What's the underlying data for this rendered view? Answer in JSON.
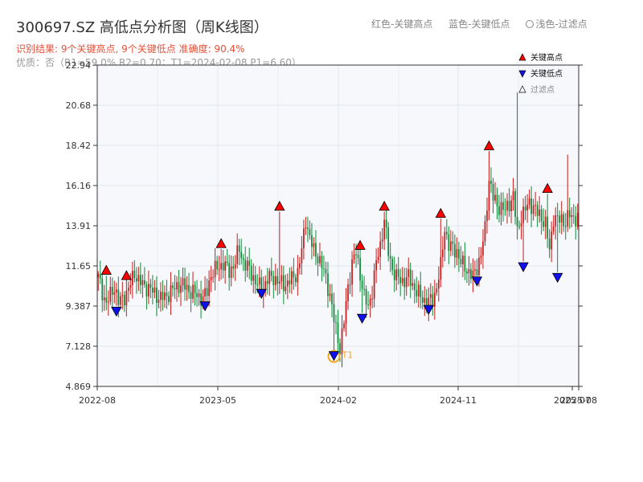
{
  "title": "300697.SZ 高低点分析图（周K线图）",
  "top_legend": {
    "red": "红色-关键高点",
    "blue": "蓝色-关键低点",
    "light": "浅色-过滤点"
  },
  "subtitle": "识别结果: 9个关键高点, 9个关键低点  准确度: 90.4%",
  "quality_line": "优质：否（R1=59.0%  R2=0.70；T1=2024-02-08 P1=6.60）",
  "colors": {
    "up": "#c81e1e",
    "down": "#118a3a",
    "high_marker": "#ff0000",
    "low_marker": "#1010ee",
    "t1_ring": "#f5a623"
  },
  "chart_data": {
    "type": "candlestick",
    "ylim": [
      4.869,
      22.94
    ],
    "yticks": [
      "22.94",
      "20.68",
      "18.42",
      "16.16",
      "13.91",
      "11.65",
      "9.387",
      "7.128",
      "4.869"
    ],
    "xticks": [
      "2022-08",
      "2023-05",
      "2024-02",
      "2024-11",
      "2025-07",
      "2025-08"
    ],
    "legend": {
      "high": "关键高点",
      "low": "关键低点",
      "filtered": "过滤点"
    },
    "t1_label": "T1",
    "close_path": [
      [
        0,
        11.0
      ],
      [
        2,
        10.2
      ],
      [
        4,
        9.5
      ],
      [
        6,
        10.0
      ],
      [
        8,
        10.5
      ],
      [
        10,
        9.6
      ],
      [
        12,
        9.8
      ],
      [
        15,
        10.3
      ],
      [
        18,
        11.3
      ],
      [
        20,
        10.8
      ],
      [
        22,
        10.6
      ],
      [
        25,
        10.4
      ],
      [
        28,
        10.1
      ],
      [
        31,
        9.8
      ],
      [
        34,
        10.0
      ],
      [
        37,
        10.3
      ],
      [
        40,
        10.6
      ],
      [
        43,
        10.5
      ],
      [
        46,
        10.2
      ],
      [
        49,
        10.0
      ],
      [
        52,
        9.8
      ],
      [
        54,
        10.2
      ],
      [
        56,
        11.2
      ],
      [
        59,
        11.5
      ],
      [
        62,
        11.8
      ],
      [
        65,
        11.3
      ],
      [
        68,
        11.9
      ],
      [
        70,
        12.6
      ],
      [
        72,
        11.9
      ],
      [
        75,
        11.4
      ],
      [
        78,
        10.8
      ],
      [
        81,
        10.3
      ],
      [
        84,
        10.9
      ],
      [
        87,
        11.0
      ],
      [
        90,
        10.7
      ],
      [
        93,
        10.6
      ],
      [
        96,
        10.9
      ],
      [
        99,
        11.3
      ],
      [
        101,
        12.5
      ],
      [
        103,
        14.3
      ],
      [
        105,
        13.2
      ],
      [
        107,
        12.5
      ],
      [
        109,
        12.2
      ],
      [
        111,
        11.6
      ],
      [
        113,
        11.0
      ],
      [
        115,
        10.0
      ],
      [
        117,
        8.6
      ],
      [
        119,
        7.6
      ],
      [
        120,
        7.0
      ],
      [
        122,
        8.5
      ],
      [
        124,
        10.5
      ],
      [
        126,
        11.8
      ],
      [
        128,
        12.4
      ],
      [
        130,
        11.2
      ],
      [
        132,
        9.9
      ],
      [
        134,
        9.3
      ],
      [
        136,
        10.3
      ],
      [
        138,
        11.8
      ],
      [
        140,
        12.8
      ],
      [
        142,
        14.3
      ],
      [
        144,
        12.4
      ],
      [
        146,
        11.5
      ],
      [
        148,
        11.0
      ],
      [
        151,
        10.8
      ],
      [
        154,
        11.0
      ],
      [
        157,
        10.4
      ],
      [
        160,
        9.9
      ],
      [
        163,
        9.6
      ],
      [
        166,
        9.7
      ],
      [
        168,
        10.5
      ],
      [
        170,
        11.6
      ],
      [
        172,
        13.8
      ],
      [
        174,
        12.8
      ],
      [
        176,
        12.6
      ],
      [
        178,
        12.5
      ],
      [
        180,
        11.8
      ],
      [
        182,
        11.6
      ],
      [
        184,
        11.3
      ],
      [
        186,
        11.0
      ],
      [
        188,
        11.6
      ],
      [
        190,
        12.3
      ],
      [
        192,
        13.7
      ],
      [
        194,
        16.6
      ],
      [
        196,
        15.5
      ],
      [
        198,
        15.0
      ],
      [
        200,
        15.0
      ],
      [
        202,
        14.7
      ],
      [
        204,
        15.2
      ],
      [
        206,
        15.6
      ],
      [
        208,
        13.5
      ],
      [
        210,
        14.5
      ],
      [
        212,
        14.8
      ],
      [
        214,
        15.2
      ],
      [
        216,
        15.0
      ],
      [
        218,
        14.6
      ],
      [
        220,
        14.4
      ],
      [
        222,
        14.0
      ],
      [
        224,
        12.5
      ],
      [
        226,
        14.4
      ],
      [
        228,
        14.2
      ],
      [
        230,
        14.3
      ],
      [
        232,
        14.1
      ],
      [
        234,
        14.5
      ],
      [
        236,
        14.4
      ],
      [
        238,
        14.3
      ]
    ],
    "n_bars": 239,
    "wick_min": 0.15,
    "wick_range": 0.6,
    "high_points": [
      {
        "i": 4,
        "v": 11.4
      },
      {
        "i": 14,
        "v": 11.1
      },
      {
        "i": 61,
        "v": 12.9
      },
      {
        "i": 90,
        "v": 15.0
      },
      {
        "i": 130,
        "v": 12.8
      },
      {
        "i": 142,
        "v": 15.0
      },
      {
        "i": 170,
        "v": 14.6
      },
      {
        "i": 194,
        "v": 18.4
      },
      {
        "i": 223,
        "v": 16.0
      }
    ],
    "low_points": [
      {
        "i": 9,
        "v": 9.1
      },
      {
        "i": 53,
        "v": 9.4
      },
      {
        "i": 81,
        "v": 10.1
      },
      {
        "i": 117,
        "v": 6.6
      },
      {
        "i": 131,
        "v": 8.7
      },
      {
        "i": 164,
        "v": 9.2
      },
      {
        "i": 188,
        "v": 10.8
      },
      {
        "i": 211,
        "v": 11.6
      },
      {
        "i": 228,
        "v": 11.0
      }
    ],
    "spikes": [
      {
        "i": 208,
        "v": 21.4
      },
      {
        "i": 233,
        "v": 17.9
      },
      {
        "i": 196,
        "v": 16.6
      }
    ],
    "t1_index": 117
  }
}
